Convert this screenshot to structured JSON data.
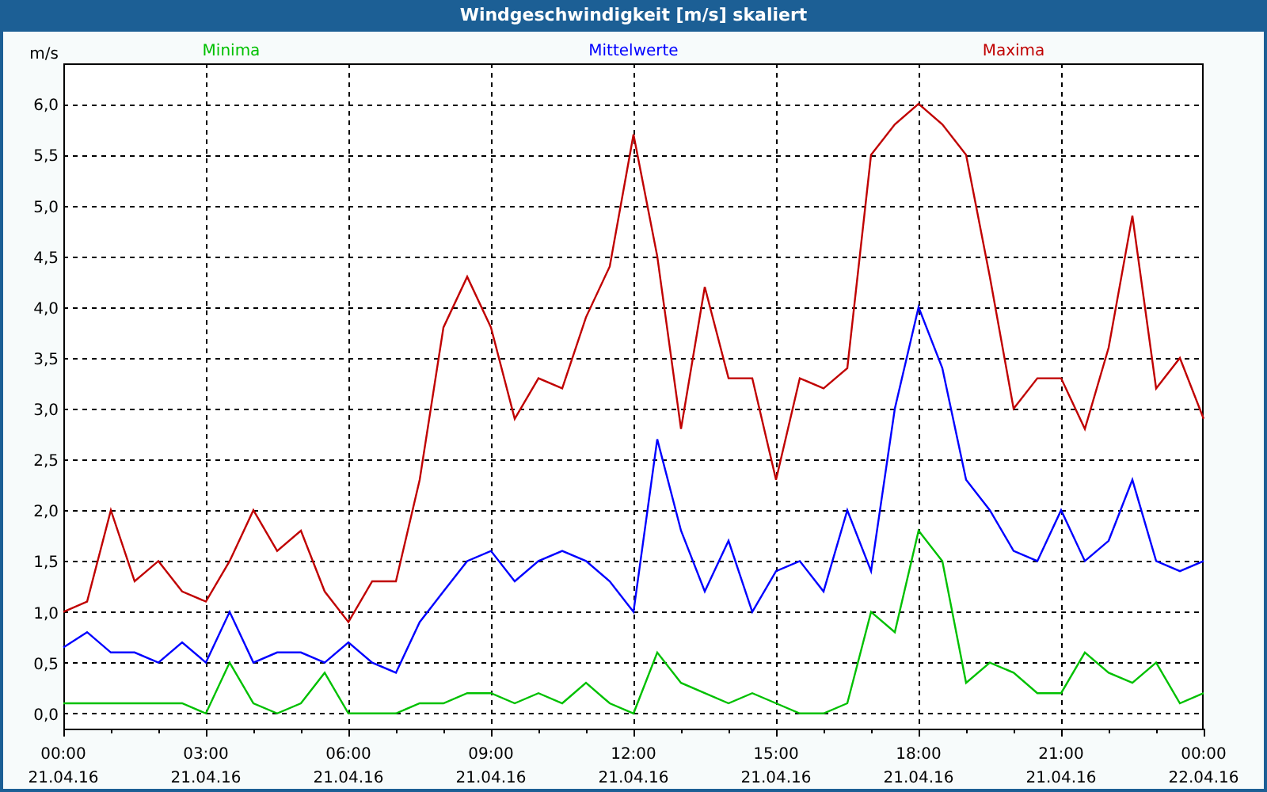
{
  "window": {
    "title": "Windgeschwindigkeit [m/s] skaliert"
  },
  "chart": {
    "chart_data": {
      "type": "line",
      "ylabel": "m/s",
      "categories": [
        "00:00 21.04.16",
        null,
        null,
        null,
        null,
        null,
        "03:00 21.04.16",
        null,
        null,
        null,
        null,
        null,
        "06:00 21.04.16",
        null,
        null,
        null,
        null,
        null,
        "09:00 21.04.16",
        null,
        null,
        null,
        null,
        null,
        "12:00 21.04.16",
        null,
        null,
        null,
        null,
        null,
        "15:00 21.04.16",
        null,
        null,
        null,
        null,
        null,
        "18:00 21.04.16",
        null,
        null,
        null,
        null,
        null,
        "21:00 21.04.16",
        null,
        null,
        null,
        null,
        null,
        "00:00 22.04.16"
      ],
      "series": [
        {
          "name": "Minima",
          "color": "#00c000",
          "values": [
            0.1,
            0.1,
            0.1,
            0.1,
            0.1,
            0.1,
            0.0,
            0.5,
            0.1,
            0.0,
            0.1,
            0.4,
            0.0,
            0.0,
            0.0,
            0.1,
            0.1,
            0.2,
            0.2,
            0.1,
            0.2,
            0.1,
            0.3,
            0.1,
            0.0,
            0.6,
            0.3,
            0.2,
            0.1,
            0.2,
            0.1,
            0.0,
            0.0,
            0.1,
            1.0,
            0.8,
            1.8,
            1.5,
            0.3,
            0.5,
            0.4,
            0.2,
            0.2,
            0.6,
            0.4,
            0.3,
            0.5,
            0.1,
            0.2
          ]
        },
        {
          "name": "Mittelwerte",
          "color": "#0000ff",
          "values": [
            0.65,
            0.8,
            0.6,
            0.6,
            0.5,
            0.7,
            0.5,
            1.0,
            0.5,
            0.6,
            0.6,
            0.5,
            0.7,
            0.5,
            0.4,
            0.9,
            1.2,
            1.5,
            1.6,
            1.3,
            1.5,
            1.6,
            1.5,
            1.3,
            1.0,
            2.7,
            1.8,
            1.2,
            1.7,
            1.0,
            1.4,
            1.5,
            1.2,
            2.0,
            1.4,
            3.0,
            4.0,
            3.4,
            2.3,
            2.0,
            1.6,
            1.5,
            2.0,
            1.5,
            1.7,
            2.3,
            1.5,
            1.4,
            1.5
          ]
        },
        {
          "name": "Maxima",
          "color": "#c00000",
          "values": [
            1.0,
            1.1,
            2.0,
            1.3,
            1.5,
            1.2,
            1.1,
            1.5,
            2.0,
            1.6,
            1.8,
            1.2,
            0.9,
            1.3,
            1.3,
            2.3,
            3.8,
            4.3,
            3.8,
            2.9,
            3.3,
            3.2,
            3.9,
            4.4,
            5.7,
            4.5,
            2.8,
            4.2,
            3.3,
            3.3,
            2.3,
            3.3,
            3.2,
            3.4,
            5.5,
            5.8,
            6.0,
            5.8,
            5.5,
            4.3,
            3.0,
            3.3,
            3.3,
            2.8,
            3.6,
            4.9,
            3.2,
            3.5,
            2.9
          ]
        }
      ],
      "ylim": [
        -0.15,
        6.4
      ],
      "grid": true,
      "yticks": [
        {
          "value": 0,
          "label": "0,0"
        },
        {
          "value": 0.5,
          "label": "0,5"
        },
        {
          "value": 1,
          "label": "1,0"
        },
        {
          "value": 1.5,
          "label": "1,5"
        },
        {
          "value": 2,
          "label": "2,0"
        },
        {
          "value": 2.5,
          "label": "2,5"
        },
        {
          "value": 3,
          "label": "3,0"
        },
        {
          "value": 3.5,
          "label": "3,5"
        },
        {
          "value": 4,
          "label": "4,0"
        },
        {
          "value": 4.5,
          "label": "4,5"
        },
        {
          "value": 5,
          "label": "5,0"
        },
        {
          "value": 5.5,
          "label": "5,5"
        },
        {
          "value": 6,
          "label": "6,0"
        }
      ]
    }
  }
}
